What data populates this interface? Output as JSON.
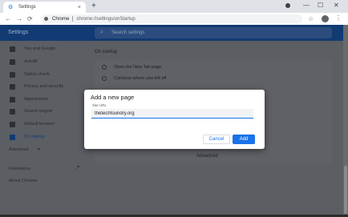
{
  "browser": {
    "tab": {
      "title": "Settings",
      "favicon": "settings-gear-icon",
      "close": "×"
    },
    "new_tab_label": "+",
    "window_controls": {
      "minimize": "—",
      "maximize": "☐",
      "close": "✕"
    },
    "nav": {
      "back": "←",
      "forward": "→",
      "reload": "⟳"
    },
    "omnibox": {
      "chip": "Chrome",
      "url": "chrome://settings/onStartup"
    },
    "star": "☆",
    "menu": "⋮"
  },
  "settings": {
    "header_title": "Settings",
    "search_placeholder": "Search settings",
    "search_icon": "⌕",
    "nav_items": [
      {
        "label": "You and Google",
        "icon": "person-icon"
      },
      {
        "label": "Autofill",
        "icon": "clipboard-icon"
      },
      {
        "label": "Safety check",
        "icon": "shield-icon"
      },
      {
        "label": "Privacy and security",
        "icon": "privacy-shield-icon"
      },
      {
        "label": "Appearance",
        "icon": "palette-icon"
      },
      {
        "label": "Search engine",
        "icon": "search-icon"
      },
      {
        "label": "Default browser",
        "icon": "browser-icon"
      },
      {
        "label": "On startup",
        "icon": "power-icon"
      }
    ],
    "advanced_label": "Advanced",
    "advanced_caret": "▾",
    "extensions_label": "Extensions",
    "external_link": "↗",
    "about_label": "About Chrome",
    "section_title": "On startup",
    "options": [
      {
        "label": "Open the New Tab page"
      },
      {
        "label": "Continue where you left off"
      }
    ],
    "advanced_footer": "Advanced"
  },
  "dialog": {
    "title": "Add a new page",
    "field_label": "Site URL",
    "field_value": "thetechfoundry.org",
    "cancel": "Cancel",
    "add": "Add"
  },
  "colors": {
    "accent": "#1a73e8",
    "header": "#123a73"
  }
}
